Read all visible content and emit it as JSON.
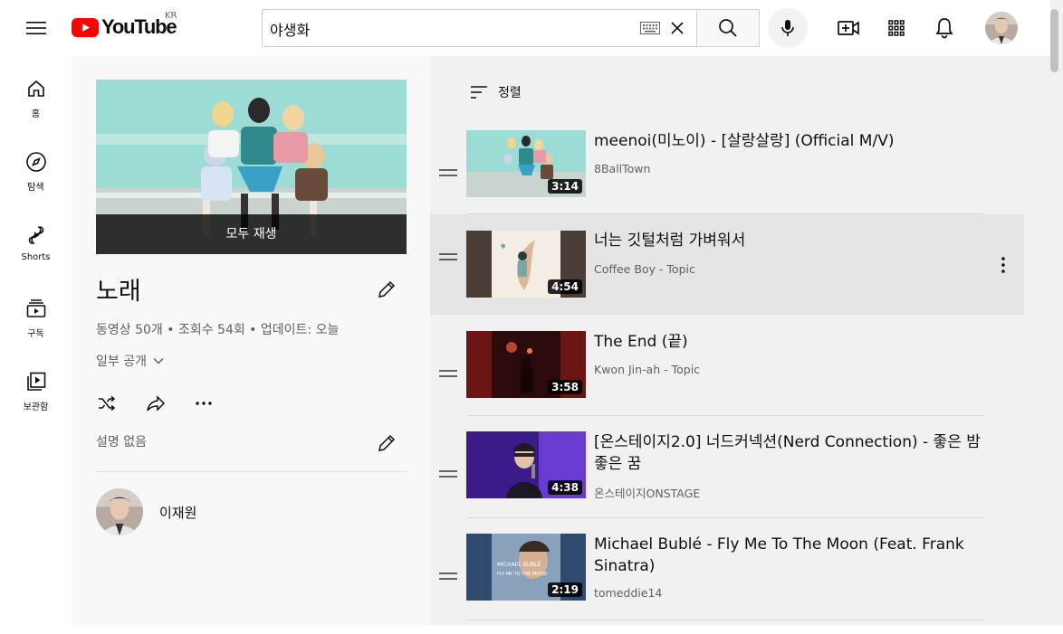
{
  "header": {
    "logo_text": "YouTube",
    "region": "KR",
    "search_value": "야생화"
  },
  "nav": [
    {
      "label": "홈",
      "icon": "home-icon"
    },
    {
      "label": "탐색",
      "icon": "compass-icon"
    },
    {
      "label": "Shorts",
      "icon": "shorts-icon"
    },
    {
      "label": "구독",
      "icon": "subscriptions-icon"
    },
    {
      "label": "보관함",
      "icon": "library-icon"
    }
  ],
  "playlist": {
    "play_all": "모두 재생",
    "title": "노래",
    "meta": "동영상 50개 • 조회수 54회 • 업데이트: 오늘",
    "privacy": "일부 공개",
    "description": "설명 없음",
    "owner": "이재원"
  },
  "sort_label": "정렬",
  "videos": [
    {
      "title": "meenoi(미노이) - [살랑살랑] (Official M/V)",
      "channel": "8BallTown",
      "duration": "3:14"
    },
    {
      "title": "너는 깃털처럼 가벼워서",
      "channel": "Coffee Boy - Topic",
      "duration": "4:54"
    },
    {
      "title": "The End (끝)",
      "channel": "Kwon Jin-ah - Topic",
      "duration": "3:58"
    },
    {
      "title": "[온스테이지2.0] 너드커넥션(Nerd Connection) - 좋은 밤 좋은 꿈",
      "channel": "온스테이지ONSTAGE",
      "duration": "4:38"
    },
    {
      "title": "Michael Bublé - Fly Me To The Moon (Feat. Frank Sinatra)",
      "channel": "tomeddie14",
      "duration": "2:19"
    }
  ],
  "colors": {
    "brand_red": "#ff0000",
    "text": "#0f0f0f",
    "secondary": "#606060"
  }
}
